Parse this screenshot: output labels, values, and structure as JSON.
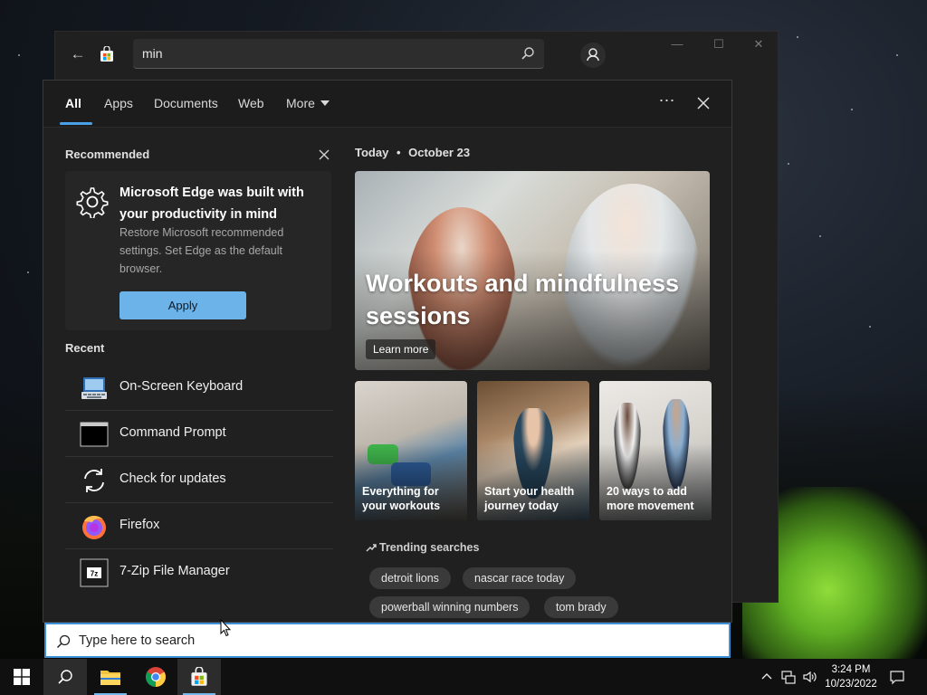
{
  "store_window": {
    "search_value": "min",
    "minimize": "—",
    "maximize": "☐",
    "close": "✕"
  },
  "flyout": {
    "tabs": [
      "All",
      "Apps",
      "Documents",
      "Web",
      "More"
    ],
    "active_tab": "All",
    "dots": "⋯"
  },
  "recommended": {
    "heading": "Recommended",
    "card_title": "Microsoft Edge was built with your productivity in mind",
    "card_desc": "Restore Microsoft recommended settings. Set Edge as the default browser.",
    "apply_label": "Apply"
  },
  "recent": {
    "heading": "Recent",
    "items": [
      {
        "label": "On-Screen Keyboard",
        "icon": "keyboard-icon"
      },
      {
        "label": "Command Prompt",
        "icon": "terminal-icon"
      },
      {
        "label": "Check for updates",
        "icon": "sync-icon"
      },
      {
        "label": "Firefox",
        "icon": "firefox-icon"
      },
      {
        "label": "7-Zip File Manager",
        "icon": "archive-icon"
      }
    ]
  },
  "today": {
    "label": "Today",
    "separator": "•",
    "date": "October 23",
    "hero_title": "Workouts and mindfulness sessions",
    "learn_more": "Learn more",
    "tiles": [
      {
        "label": "Everything for your workouts"
      },
      {
        "label": "Start your health journey today"
      },
      {
        "label": "20 ways to add more movement"
      }
    ]
  },
  "trending": {
    "heading": "Trending searches",
    "chips": [
      "detroit lions",
      "nascar race today",
      "powerball winning numbers",
      "tom brady"
    ]
  },
  "searchbox": {
    "placeholder": "Type here to search"
  },
  "taskbar": {
    "time": "3:24 PM",
    "date": "10/23/2022"
  },
  "colors": {
    "accent": "#4aa0e6",
    "apply_button": "#6cb3ea",
    "flyout_bg": "#202020"
  }
}
